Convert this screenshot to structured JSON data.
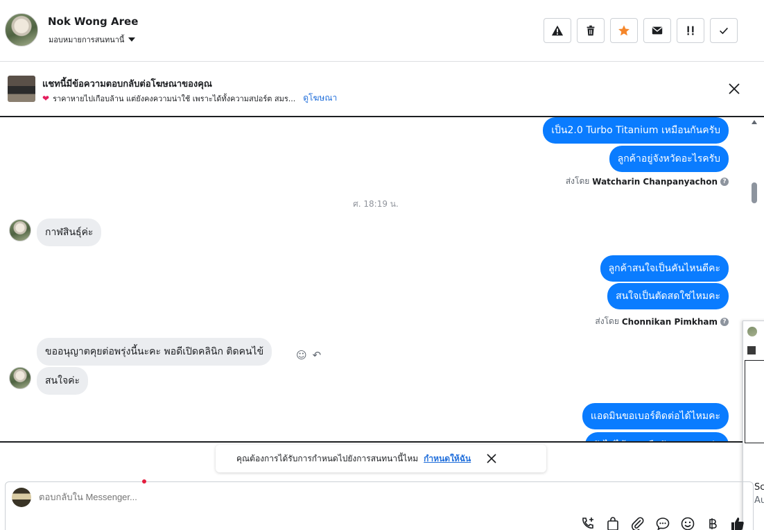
{
  "header": {
    "name": "Nok Wong Aree",
    "assign_label": "มอบหมายการสนทนานี้"
  },
  "ad_banner": {
    "title": "แชทนี้มีข้อความตอบกลับต่อโฆษณาของคุณ",
    "description": "ราคาหายไปเกือบล้าน แต่ยังคงความน่าใช้ เพราะได้ทั้งความสปอร์ต สมร...",
    "link_label": "ดูโฆษณา"
  },
  "messages": {
    "out1": "เป็น2.0 Turbo Titanium เหมือนกันครับ",
    "out2": "ลูกค้าอยู่จังหวัดอะไรครับ",
    "sentby1_prefix": "ส่งโดย",
    "sentby1_name": "Watcharin Chanpanyachon",
    "timestamp": "ศ. 18:19 น.",
    "in1": "กาฬสินธุ์ค่ะ",
    "out3": "ลูกค้าสนใจเป็นคันไหนดีคะ",
    "out4": "สนใจเป็นตัดสดใช่ไหมคะ",
    "sentby2_prefix": "ส่งโดย",
    "sentby2_name": "Chonnikan Pimkham",
    "in2": "ขออนุญาตคุยต่อพรุ่งนี้นะคะ พอดีเปิดคลินิก ติดคนไข้",
    "in3": "สนใจค่ะ",
    "out5": "แอดมินขอเบอร์ติดต่อได้ไหมคะ",
    "out6_partial": "ยังไม่ได้จองหรือยังคะ ทราบต่อ"
  },
  "side_panel": {
    "text1": "Sc",
    "text2": "Au"
  },
  "prompt": {
    "text": "คุณต้องการได้รับการกำหนดไปยังการสนทนานี้ไหม",
    "link": "กำหนดให้ฉัน"
  },
  "composer": {
    "placeholder": "ตอบกลับใน Messenger..."
  },
  "colors": {
    "accent": "#0a7cff",
    "link": "#216fdb",
    "star": "#f5862a"
  }
}
